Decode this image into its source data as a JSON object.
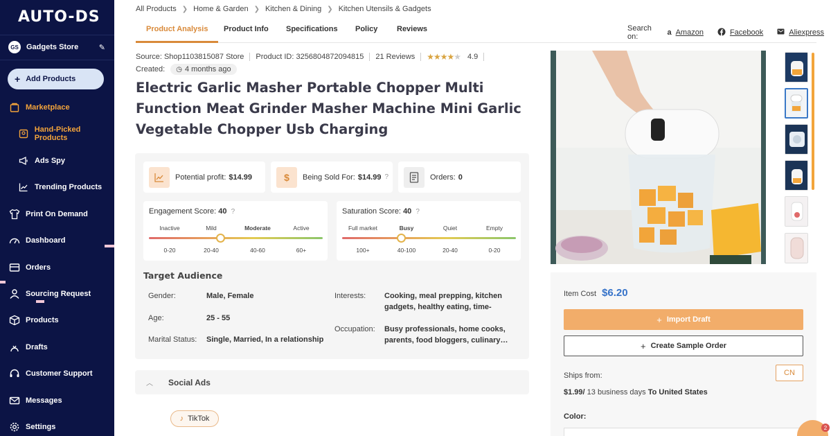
{
  "sidebar": {
    "logo": "AUTO-DS",
    "store_badge": "GS",
    "store_name": "Gadgets Store",
    "add_products": "Add Products",
    "items": [
      {
        "label": "Marketplace",
        "icon": "marketplace-icon"
      },
      {
        "label": "Hand-Picked Products",
        "icon": "hand-picked-icon"
      },
      {
        "label": "Ads Spy",
        "icon": "megaphone-icon"
      },
      {
        "label": "Trending Products",
        "icon": "trend-icon"
      },
      {
        "label": "Print On Demand",
        "icon": "shirt-icon"
      },
      {
        "label": "Dashboard",
        "icon": "gauge-icon"
      },
      {
        "label": "Orders",
        "icon": "orders-icon"
      },
      {
        "label": "Sourcing Request",
        "icon": "sourcing-icon"
      },
      {
        "label": "Products",
        "icon": "box-icon"
      },
      {
        "label": "Drafts",
        "icon": "drafts-icon"
      },
      {
        "label": "Customer Support",
        "icon": "headset-icon"
      },
      {
        "label": "Messages",
        "icon": "mail-icon"
      },
      {
        "label": "Settings",
        "icon": "gear-icon"
      }
    ]
  },
  "breadcrumb": [
    "All Products",
    "Home & Garden",
    "Kitchen & Dining",
    "Kitchen Utensils & Gadgets"
  ],
  "tabs": [
    "Product Analysis",
    "Product Info",
    "Specifications",
    "Policy",
    "Reviews"
  ],
  "search_on": {
    "label": "Search on:",
    "links": [
      "Amazon",
      "Facebook",
      "Aliexpress"
    ]
  },
  "product": {
    "source": "Source: Shop1103815087 Store",
    "product_id": "Product ID: 3256804872094815",
    "reviews": "21 Reviews",
    "rating": "4.9",
    "rating_stars": 4,
    "created_label": "Created:",
    "created_value": "4 months ago",
    "title": "Electric Garlic Masher Portable Chopper Multi Function Meat Grinder Masher Machine Mini Garlic Vegetable Chopper Usb Charging"
  },
  "stats": {
    "profit_label": "Potential profit:",
    "profit_value": "$14.99",
    "sold_label": "Being Sold For:",
    "sold_value": "$14.99",
    "orders_label": "Orders:",
    "orders_value": "0"
  },
  "engagement": {
    "title": "Engagement Score:",
    "value": "40",
    "labels": [
      "Inactive",
      "Mild",
      "Moderate",
      "Active"
    ],
    "ranges": [
      "0-20",
      "20-40",
      "40-60",
      "60+"
    ],
    "active_index": 2,
    "level": 0.4
  },
  "saturation": {
    "title": "Saturation Score:",
    "value": "40",
    "labels": [
      "Full market",
      "Busy",
      "Quiet",
      "Empty"
    ],
    "ranges": [
      "100+",
      "40-100",
      "20-40",
      "0-20"
    ],
    "active_index": 1,
    "level": 0.4
  },
  "audience": {
    "title": "Target Audience",
    "gender_label": "Gender:",
    "gender": "Male, Female",
    "age_label": "Age:",
    "age": "25 - 55",
    "marital_label": "Marital Status:",
    "marital": "Single, Married, In a relationship",
    "interests_label": "Interests:",
    "interests": "Cooking, meal prepping, kitchen gadgets, healthy eating, time-saving…",
    "occupation_label": "Occupation:",
    "occupation": "Busy professionals, home cooks, parents, food bloggers, culinary…"
  },
  "social": {
    "label": "Social Ads",
    "tiktok": "TikTok"
  },
  "buy": {
    "item_cost_label": "Item Cost",
    "item_cost": "$6.20",
    "import_draft": "Import Draft",
    "create_sample": "Create Sample Order",
    "ships_from": "Ships from:",
    "cn": "CN",
    "shipping_price": "$1.99/",
    "shipping_days": "13 business days",
    "shipping_to": "To United States",
    "color_label": "Color:"
  },
  "chat_badge": "2",
  "colors": {
    "sidebar_bg": "#0c1445",
    "accent": "#f2ad6a",
    "active_nav": "#f3a43b",
    "price": "#3673c9"
  }
}
